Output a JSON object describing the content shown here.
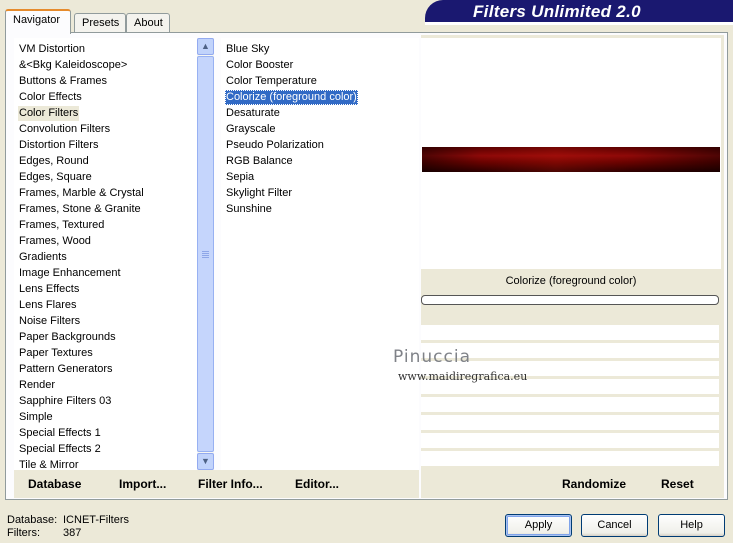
{
  "tabs": [
    {
      "label": "Navigator",
      "active": true
    },
    {
      "label": "Presets",
      "active": false
    },
    {
      "label": "About",
      "active": false
    }
  ],
  "banner": {
    "title": "Filters Unlimited 2.0"
  },
  "categories": {
    "selected": "Color Filters",
    "items": [
      "VM Distortion",
      "&<Bkg Kaleidoscope>",
      "Buttons & Frames",
      "Color Effects",
      "Color Filters",
      "Convolution Filters",
      "Distortion Filters",
      "Edges, Round",
      "Edges, Square",
      "Frames, Marble & Crystal",
      "Frames, Stone & Granite",
      "Frames, Textured",
      "Frames, Wood",
      "Gradients",
      "Image Enhancement",
      "Lens Effects",
      "Lens Flares",
      "Noise Filters",
      "Paper Backgrounds",
      "Paper Textures",
      "Pattern Generators",
      "Render",
      "Sapphire Filters 03",
      "Simple",
      "Special Effects 1",
      "Special Effects 2",
      "Tile & Mirror"
    ]
  },
  "filters": {
    "selected": "Colorize (foreground color)",
    "items": [
      "Blue Sky",
      "Color Booster",
      "Color Temperature",
      "Colorize (foreground color)",
      "Desaturate",
      "Grayscale",
      "Pseudo Polarization",
      "RGB Balance",
      "Sepia",
      "Skylight Filter",
      "Sunshine"
    ]
  },
  "preview": {
    "filter_name": "Colorize (foreground color)",
    "strip_color": "#8e0908"
  },
  "watermark": {
    "name": "Pinuccia",
    "url": "www.maidiregrafica.eu"
  },
  "panel_buttons": {
    "database": "Database",
    "import": "Import...",
    "filter_info": "Filter Info...",
    "editor": "Editor...",
    "randomize": "Randomize",
    "reset": "Reset"
  },
  "footer": {
    "database_label": "Database:",
    "database_value": "ICNET-Filters",
    "filters_label": "Filters:",
    "filters_value": "387"
  },
  "dialog_buttons": {
    "apply": "Apply",
    "cancel": "Cancel",
    "help": "Help"
  },
  "colors": {
    "selection": "#316ac5",
    "banner": "#1a1870",
    "tab_accent": "#e68b2c"
  }
}
